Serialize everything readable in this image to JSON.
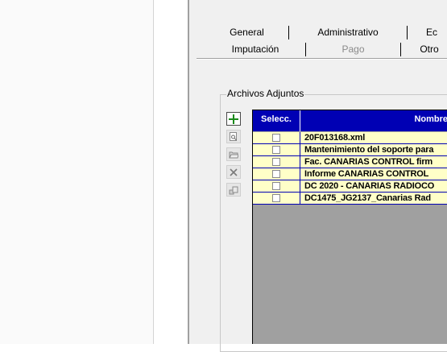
{
  "tabs_row1": [
    {
      "label": "General"
    },
    {
      "label": "Administrativo"
    },
    {
      "label": "Ec"
    }
  ],
  "tabs_row2": [
    {
      "label": "Imputación"
    },
    {
      "label": "Pago",
      "disabled": true
    },
    {
      "label": "Otro"
    }
  ],
  "attachments": {
    "group_label": "Archivos Adjuntos",
    "toolbar": [
      {
        "icon": "add-icon"
      },
      {
        "icon": "preview-icon"
      },
      {
        "icon": "open-folder-icon"
      },
      {
        "icon": "delete-icon"
      },
      {
        "icon": "scan-icon"
      }
    ],
    "columns": {
      "select": "Selecc.",
      "name": "Nombre"
    },
    "rows": [
      {
        "checked": false,
        "name": "20F013168.xml"
      },
      {
        "checked": false,
        "name": "Mantenimiento del soporte para"
      },
      {
        "checked": false,
        "name": "Fac. CANARIAS CONTROL firm"
      },
      {
        "checked": false,
        "name": "Informe CANARIAS CONTROL"
      },
      {
        "checked": false,
        "name": "DC 2020 - CANARIAS RADIOCO"
      },
      {
        "checked": false,
        "name": "DC1475_JG2137_Canarias Rad"
      }
    ]
  },
  "colors": {
    "grid_header": "#0000b4",
    "row_background": "#ffffc8",
    "grid_empty": "#a0a0a0",
    "add_icon": "#1a8a1a"
  }
}
